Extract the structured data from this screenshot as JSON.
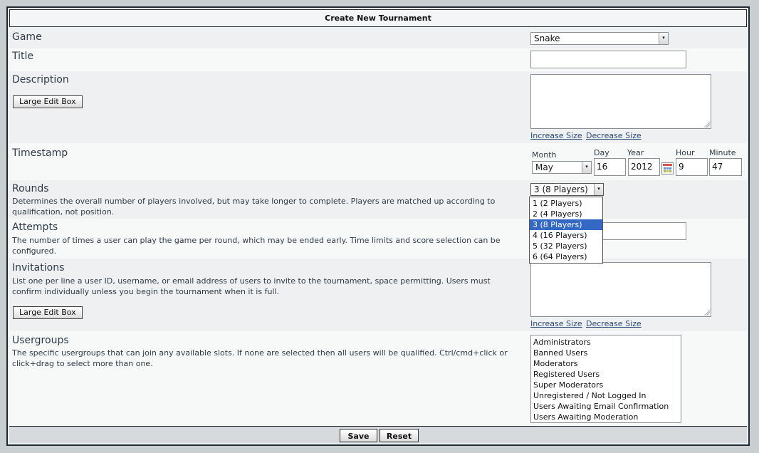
{
  "form": {
    "title": "Create New Tournament",
    "game": {
      "label": "Game",
      "value": "Snake"
    },
    "title_field": {
      "label": "Title",
      "value": ""
    },
    "description": {
      "label": "Description",
      "large_edit": "Large Edit Box",
      "increase": "Increase Size",
      "decrease": "Decrease Size"
    },
    "timestamp": {
      "label": "Timestamp",
      "month_label": "Month",
      "month_value": "May",
      "day_label": "Day",
      "day_value": "16",
      "year_label": "Year",
      "year_value": "2012",
      "hour_label": "Hour",
      "hour_value": "9",
      "minute_label": "Minute",
      "minute_value": "47"
    },
    "rounds": {
      "label": "Rounds",
      "desc": "Determines the overall number of players involved, but may take longer to complete. Players are matched up according to qualification, not position.",
      "value": "3 (8 Players)",
      "options": [
        "1 (2 Players)",
        "2 (4 Players)",
        "3 (8 Players)",
        "4 (16 Players)",
        "5 (32 Players)",
        "6 (64 Players)"
      ],
      "selected_index": 2
    },
    "attempts": {
      "label": "Attempts",
      "desc": "The number of times a user can play the game per round, which may be ended early. Time limits and score selection can be configured."
    },
    "invitations": {
      "label": "Invitations",
      "desc": "List one per line a user ID, username, or email address of users to invite to the tournament, space permitting. Users must confirm individually unless you begin the tournament when it is full.",
      "large_edit": "Large Edit Box",
      "increase": "Increase Size",
      "decrease": "Decrease Size"
    },
    "usergroups": {
      "label": "Usergroups",
      "desc": "The specific usergroups that can join any available slots. If none are selected then all users will be qualified. Ctrl/cmd+click or click+drag to select more than one.",
      "items": [
        "Administrators",
        "Banned Users",
        "Moderators",
        "Registered Users",
        "Super Moderators",
        "Unregistered / Not Logged In",
        "Users Awaiting Email Confirmation",
        "Users Awaiting Moderation"
      ]
    },
    "save": "Save",
    "reset": "Reset"
  },
  "icons": {
    "dropdown_arrow": "▾",
    "calendar": "calendar-icon"
  }
}
